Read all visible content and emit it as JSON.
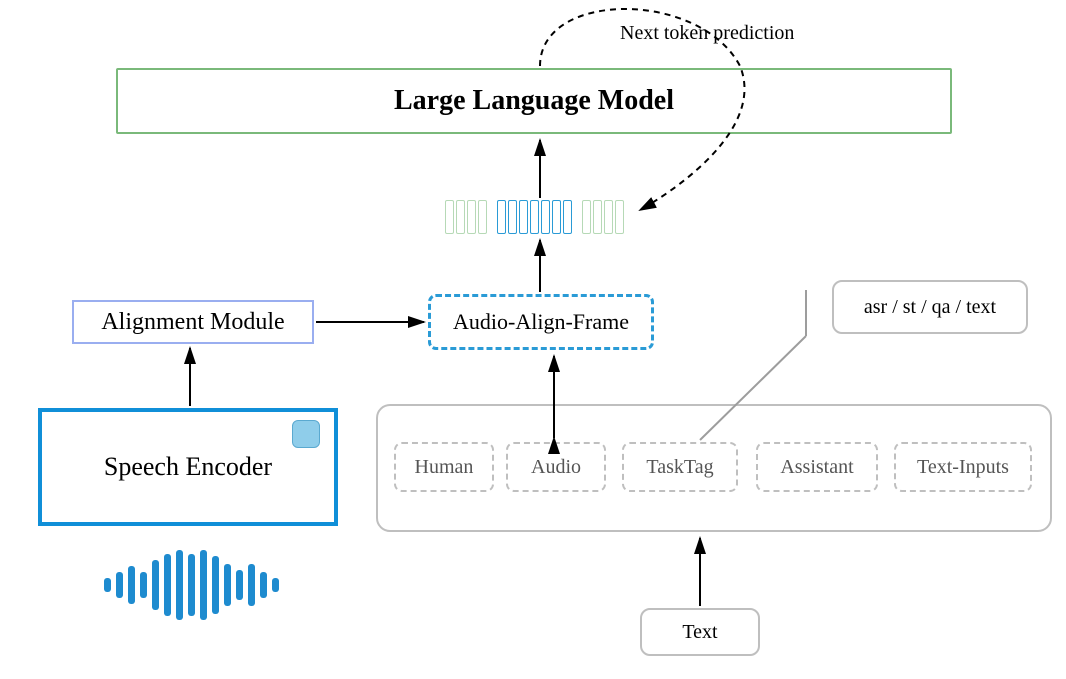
{
  "annotation": {
    "next_token": "Next token prediction"
  },
  "llm": {
    "label": "Large Language Model"
  },
  "alignment_module": {
    "label": "Alignment Module"
  },
  "audio_align_frame": {
    "label": "Audio-Align-Frame"
  },
  "speech_encoder": {
    "label": "Speech Encoder",
    "frozen_icon": "cube-icon"
  },
  "prompt_template": {
    "items": [
      {
        "label": "Human"
      },
      {
        "label": "Audio"
      },
      {
        "label": "TaskTag"
      },
      {
        "label": "Assistant"
      },
      {
        "label": "Text-Inputs"
      }
    ]
  },
  "task_tags": {
    "label": "asr / st / qa / text"
  },
  "text_input": {
    "label": "Text"
  },
  "tokens": {
    "left_green_count": 4,
    "blue_count": 7,
    "right_green_count": 4
  }
}
